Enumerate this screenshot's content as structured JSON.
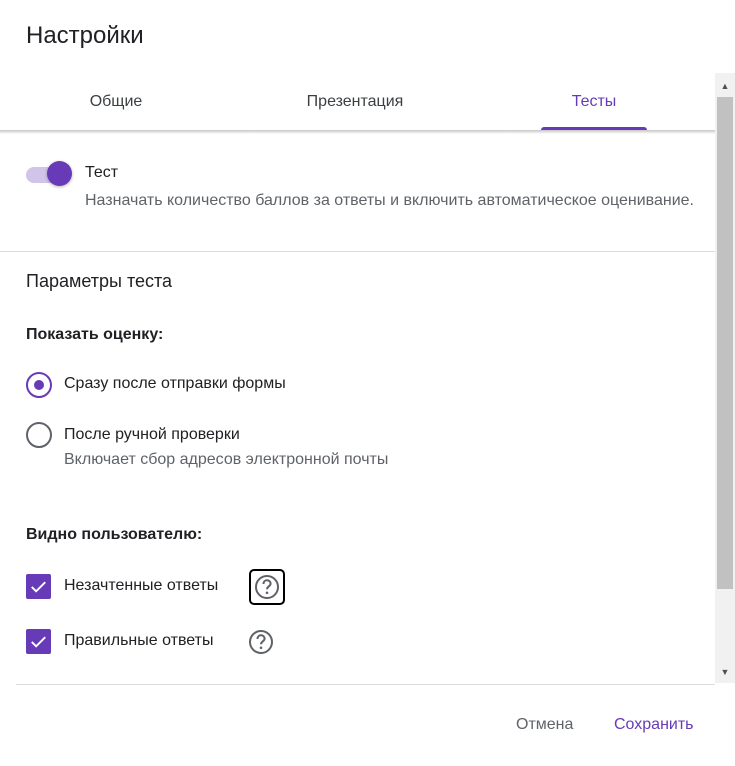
{
  "dialog": {
    "title": "Настройки"
  },
  "tabs": [
    {
      "label": "Общие",
      "active": false
    },
    {
      "label": "Презентация",
      "active": false
    },
    {
      "label": "Тесты",
      "active": true
    }
  ],
  "quiz_toggle": {
    "label": "Тест",
    "description": "Назначать количество баллов за ответы и включить автоматическое оценивание.",
    "enabled": true
  },
  "quiz_options": {
    "section_title": "Параметры теста",
    "release_grade": {
      "heading": "Показать оценку:",
      "options": [
        {
          "label": "Сразу после отправки формы",
          "selected": true,
          "sublabel": ""
        },
        {
          "label": "После ручной проверки",
          "selected": false,
          "sublabel": "Включает сбор адресов электронной почты"
        }
      ]
    },
    "respondent_can_see": {
      "heading": "Видно пользователю:",
      "items": [
        {
          "label": "Незачтенные ответы",
          "checked": true
        },
        {
          "label": "Правильные ответы",
          "checked": true
        }
      ]
    }
  },
  "buttons": {
    "cancel": "Отмена",
    "save": "Сохранить"
  },
  "colors": {
    "accent": "#673ab7",
    "accent_light": "#d1c4e9",
    "text_secondary": "#5f6368"
  },
  "icons": {
    "help": "help-circle-icon",
    "check": "check-icon"
  }
}
